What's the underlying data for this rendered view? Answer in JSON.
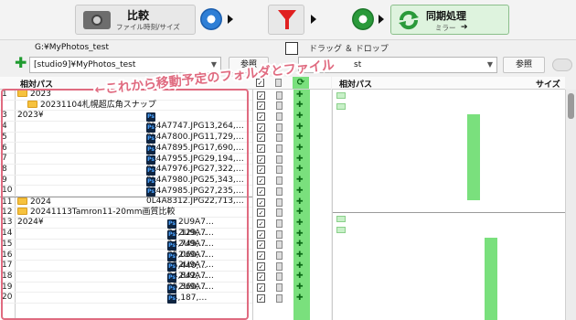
{
  "toolbar": {
    "compare_label": "比較",
    "compare_sub": "ファイル時刻/サイズ",
    "sync_label": "同期処理",
    "sync_sub": "ミラー"
  },
  "left_path": {
    "label": "G:¥MyPhotos_test",
    "value": "[studio9]¥MyPhotos_test",
    "browse": "参照"
  },
  "right_path": {
    "dnd_label": "ドラッグ ＆ ドロップ",
    "value": "st",
    "browse": "参照"
  },
  "headers": {
    "left": "相対パス",
    "right": "相対パス",
    "size": "サイズ"
  },
  "annotation": "←これから移動予定のフォルダとファイル",
  "rows": [
    {
      "num": "1",
      "kind": "folder",
      "text": "2023"
    },
    {
      "num": "",
      "kind": "folder",
      "text": "20231104札幌超広角スナップ"
    },
    {
      "num": "3",
      "prefix": "2023¥",
      "kind": "ps",
      "text": "0L4A7747.JPG13,264,…"
    },
    {
      "num": "4",
      "prefix": "",
      "kind": "ps",
      "text": "0L4A7800.JPG11,729,…"
    },
    {
      "num": "5",
      "prefix": "",
      "kind": "ps",
      "text": "0L4A7895.JPG17,690,…"
    },
    {
      "num": "6",
      "prefix": "",
      "kind": "ps",
      "text": "0L4A7955.JPG29,194,…"
    },
    {
      "num": "7",
      "prefix": "",
      "kind": "ps",
      "text": "0L4A7976.JPG27,322,…"
    },
    {
      "num": "8",
      "prefix": "",
      "kind": "ps",
      "text": "0L4A7980.JPG25,343,…"
    },
    {
      "num": "9",
      "prefix": "",
      "kind": "ps",
      "text": "0L4A7985.JPG27,235,…"
    },
    {
      "num": "10",
      "prefix": "",
      "kind": "ps",
      "text": "0L4A8312.JPG22,713,…"
    },
    {
      "num": "11",
      "kind": "folder",
      "text": "2024"
    },
    {
      "num": "12",
      "kind": "folder",
      "text": "20241113Tamron11-20mm画質比較"
    },
    {
      "num": "13",
      "prefix": "2024¥",
      "kind": "ps",
      "text": "2U9A7…34,129,…"
    },
    {
      "num": "14",
      "prefix": "",
      "kind": "ps",
      "text": "2U9A7…24,749,…"
    },
    {
      "num": "15",
      "prefix": "",
      "kind": "ps",
      "text": "2U9A7…35,060,…"
    },
    {
      "num": "16",
      "prefix": "",
      "kind": "ps",
      "text": "2U9A7…25,440,…"
    },
    {
      "num": "17",
      "prefix": "",
      "kind": "ps",
      "text": "2U9A7…34,842,…"
    },
    {
      "num": "18",
      "prefix": "",
      "kind": "ps",
      "text": "2U9A7…25,360,…"
    },
    {
      "num": "19",
      "prefix": "",
      "kind": "ps",
      "text": "2U9A7…34,187,…"
    },
    {
      "num": "20",
      "prefix": "",
      "kind": "ps",
      "text": ""
    }
  ],
  "colors": {
    "accent_green": "#7ae07d",
    "annotation_pink": "#e06b80"
  }
}
